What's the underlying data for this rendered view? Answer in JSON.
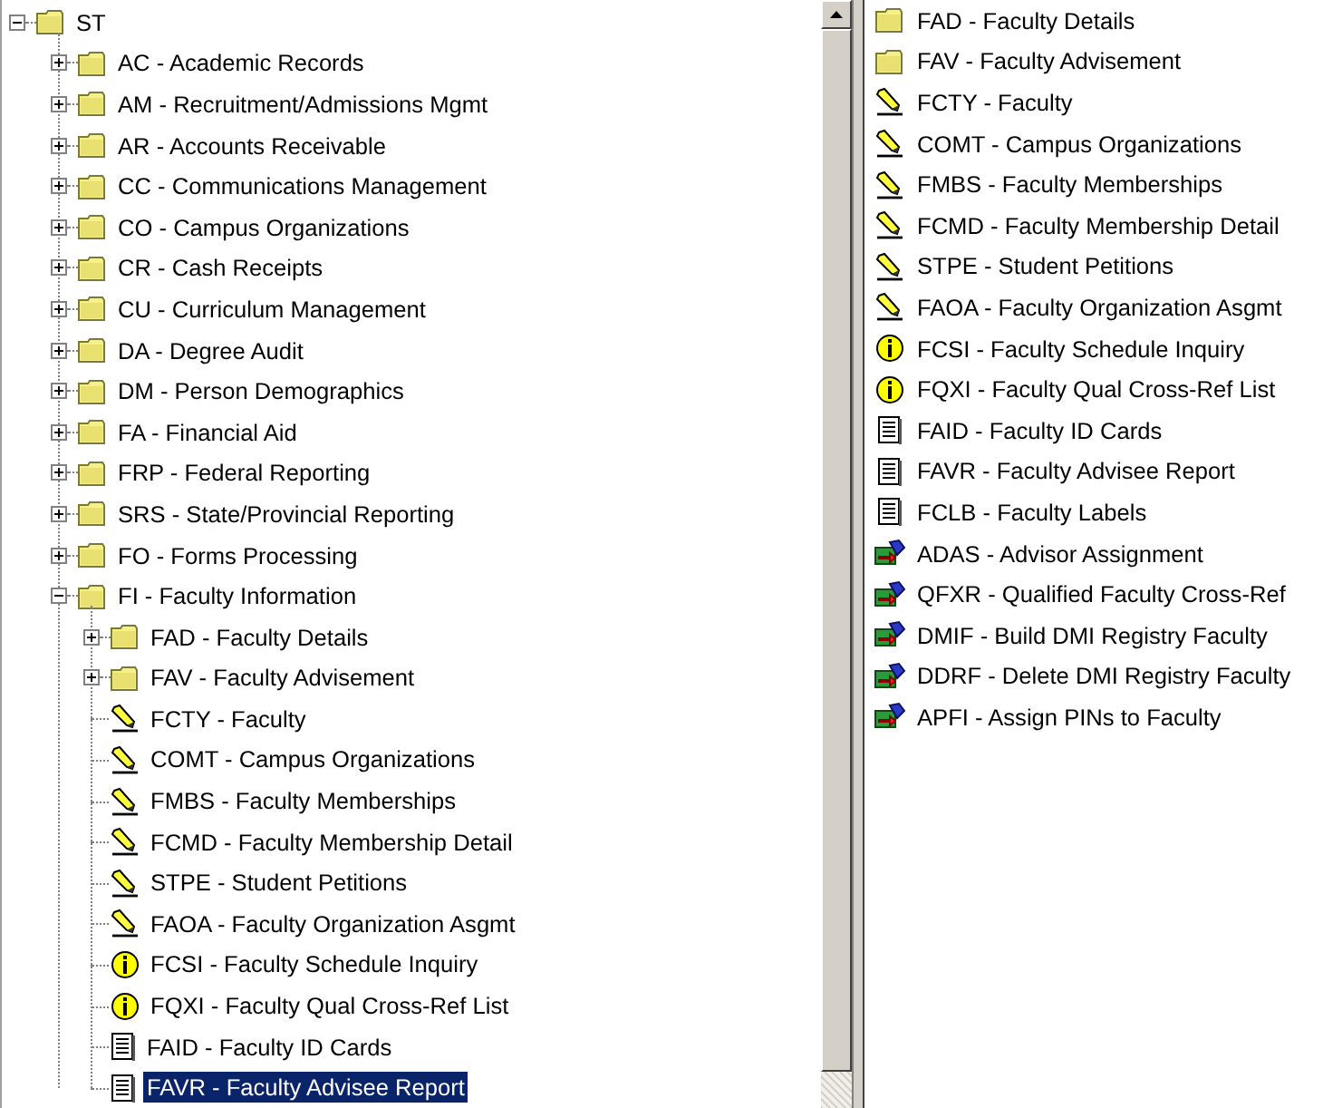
{
  "tree": {
    "label": "ST",
    "kind": "folder",
    "expanded": true,
    "selected": false,
    "children": [
      {
        "label": "AC - Academic Records",
        "kind": "folder",
        "expanded": false,
        "selected": false
      },
      {
        "label": "AM - Recruitment/Admissions Mgmt",
        "kind": "folder",
        "expanded": false,
        "selected": false
      },
      {
        "label": "AR - Accounts Receivable",
        "kind": "folder",
        "expanded": false,
        "selected": false
      },
      {
        "label": "CC - Communications Management",
        "kind": "folder",
        "expanded": false,
        "selected": false
      },
      {
        "label": "CO - Campus Organizations",
        "kind": "folder",
        "expanded": false,
        "selected": false
      },
      {
        "label": "CR - Cash Receipts",
        "kind": "folder",
        "expanded": false,
        "selected": false
      },
      {
        "label": "CU - Curriculum Management",
        "kind": "folder",
        "expanded": false,
        "selected": false
      },
      {
        "label": "DA - Degree Audit",
        "kind": "folder",
        "expanded": false,
        "selected": false
      },
      {
        "label": "DM - Person Demographics",
        "kind": "folder",
        "expanded": false,
        "selected": false
      },
      {
        "label": "FA - Financial Aid",
        "kind": "folder",
        "expanded": false,
        "selected": false
      },
      {
        "label": "FRP - Federal Reporting",
        "kind": "folder",
        "expanded": false,
        "selected": false
      },
      {
        "label": "SRS - State/Provincial Reporting",
        "kind": "folder",
        "expanded": false,
        "selected": false
      },
      {
        "label": "FO - Forms Processing",
        "kind": "folder",
        "expanded": false,
        "selected": false
      },
      {
        "label": "FI - Faculty Information",
        "kind": "folder",
        "expanded": true,
        "selected": false,
        "children": [
          {
            "label": "FAD - Faculty Details",
            "kind": "folder",
            "expanded": false,
            "selected": false
          },
          {
            "label": "FAV - Faculty Advisement",
            "kind": "folder",
            "expanded": false,
            "selected": false
          },
          {
            "label": "FCTY - Faculty",
            "kind": "edit",
            "selected": false
          },
          {
            "label": "COMT - Campus Organizations",
            "kind": "edit",
            "selected": false
          },
          {
            "label": "FMBS - Faculty Memberships",
            "kind": "edit",
            "selected": false
          },
          {
            "label": "FCMD - Faculty Membership Detail",
            "kind": "edit",
            "selected": false
          },
          {
            "label": "STPE - Student Petitions",
            "kind": "edit",
            "selected": false
          },
          {
            "label": "FAOA - Faculty Organization Asgmt",
            "kind": "edit",
            "selected": false
          },
          {
            "label": "FCSI - Faculty Schedule Inquiry",
            "kind": "info",
            "selected": false
          },
          {
            "label": "FQXI - Faculty Qual Cross-Ref List",
            "kind": "info",
            "selected": false
          },
          {
            "label": "FAID - Faculty ID Cards",
            "kind": "report",
            "selected": false
          },
          {
            "label": "FAVR - Faculty Advisee Report",
            "kind": "report",
            "selected": true
          }
        ]
      }
    ]
  },
  "list": [
    {
      "label": "FAD - Faculty Details",
      "kind": "folder",
      "selected": false
    },
    {
      "label": "FAV - Faculty Advisement",
      "kind": "folder",
      "selected": false
    },
    {
      "label": "FCTY - Faculty",
      "kind": "edit",
      "selected": false
    },
    {
      "label": "COMT - Campus Organizations",
      "kind": "edit",
      "selected": false
    },
    {
      "label": "FMBS - Faculty Memberships",
      "kind": "edit",
      "selected": false
    },
    {
      "label": "FCMD - Faculty Membership Detail",
      "kind": "edit",
      "selected": false
    },
    {
      "label": "STPE - Student Petitions",
      "kind": "edit",
      "selected": false
    },
    {
      "label": "FAOA - Faculty Organization Asgmt",
      "kind": "edit",
      "selected": false
    },
    {
      "label": "FCSI - Faculty Schedule Inquiry",
      "kind": "info",
      "selected": false
    },
    {
      "label": "FQXI - Faculty Qual Cross-Ref List",
      "kind": "info",
      "selected": false
    },
    {
      "label": "FAID - Faculty ID Cards",
      "kind": "report",
      "selected": false
    },
    {
      "label": "FAVR - Faculty Advisee Report",
      "kind": "report",
      "selected": false
    },
    {
      "label": "FCLB - Faculty Labels",
      "kind": "report",
      "selected": false
    },
    {
      "label": "ADAS - Advisor Assignment",
      "kind": "action",
      "selected": false
    },
    {
      "label": "QFXR - Qualified Faculty Cross-Ref",
      "kind": "action",
      "selected": false
    },
    {
      "label": "DMIF - Build DMI Registry Faculty",
      "kind": "action",
      "selected": false
    },
    {
      "label": "DDRF - Delete DMI Registry Faculty",
      "kind": "action",
      "selected": false
    },
    {
      "label": "APFI - Assign PINs to Faculty",
      "kind": "action",
      "selected": false
    }
  ]
}
